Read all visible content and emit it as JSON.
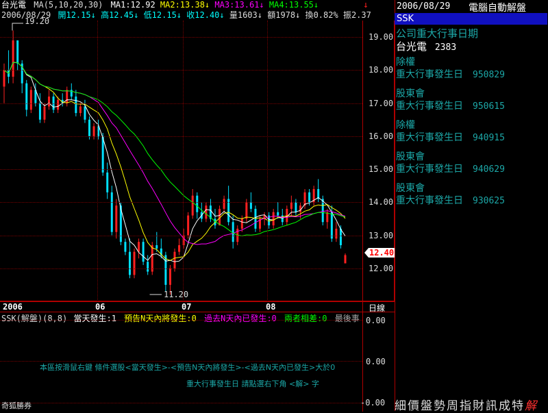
{
  "header": {
    "stock_name": "台光電",
    "ma_label": "MA(5,10,20,30)",
    "ma1": "MA1:12.92",
    "ma2": "MA2:13.38↓",
    "ma3": "MA3:13.61↓",
    "ma4": "MA4:13.55↓",
    "date": "2006/08/29",
    "open": "開12.15↓",
    "high": "高12.45↓",
    "low": "低12.15↓",
    "close": "收12.40↓",
    "volume": "量1603↓",
    "amount": "額1978↓",
    "turnover": "換0.82%",
    "amplitude": "振2.37",
    "arrow_icon": "down-arrow-icon"
  },
  "chart": {
    "yticks": [
      "19.00",
      "18.00",
      "17.00",
      "16.00",
      "15.00",
      "14.00",
      "13.00",
      "12.00"
    ],
    "current_price": "12.40",
    "high_label": "19.20",
    "low_label": "11.20",
    "xlabels": [
      "2006",
      "06",
      "07",
      "08"
    ],
    "period": "日線"
  },
  "chart_data": {
    "type": "candlestick",
    "ylim": [
      11.0,
      19.5
    ],
    "moving_averages": [
      {
        "name": "MA1",
        "last": 12.92,
        "color": "#ffffff"
      },
      {
        "name": "MA2",
        "last": 13.38,
        "color": "#ffff00"
      },
      {
        "name": "MA3",
        "last": 13.61,
        "color": "#ff00ff"
      },
      {
        "name": "MA4",
        "last": 13.55,
        "color": "#00ff00"
      }
    ],
    "candles": [
      [
        17.5,
        18.2,
        17.0,
        18.0
      ],
      [
        18.0,
        18.6,
        17.6,
        17.8
      ],
      [
        17.8,
        19.2,
        17.6,
        18.9
      ],
      [
        18.9,
        18.9,
        18.0,
        18.2
      ],
      [
        18.2,
        18.3,
        17.3,
        17.6
      ],
      [
        17.6,
        17.7,
        16.6,
        16.8
      ],
      [
        16.8,
        17.5,
        16.7,
        17.4
      ],
      [
        17.4,
        17.6,
        16.9,
        17.0
      ],
      [
        17.0,
        17.3,
        16.4,
        16.5
      ],
      [
        16.5,
        17.0,
        16.4,
        16.9
      ],
      [
        16.9,
        17.4,
        16.8,
        17.2
      ],
      [
        17.2,
        17.3,
        16.7,
        16.8
      ],
      [
        16.8,
        17.2,
        16.7,
        17.1
      ],
      [
        17.1,
        17.3,
        16.9,
        17.0
      ],
      [
        17.0,
        17.5,
        16.9,
        17.4
      ],
      [
        17.4,
        17.6,
        17.1,
        17.2
      ],
      [
        17.2,
        17.4,
        16.6,
        16.7
      ],
      [
        16.7,
        17.0,
        16.6,
        16.9
      ],
      [
        16.9,
        17.1,
        16.4,
        16.5
      ],
      [
        16.5,
        16.6,
        15.9,
        16.0
      ],
      [
        16.0,
        16.4,
        15.9,
        16.3
      ],
      [
        16.3,
        16.5,
        15.9,
        16.0
      ],
      [
        16.0,
        16.1,
        14.8,
        14.9
      ],
      [
        14.9,
        15.2,
        14.1,
        14.3
      ],
      [
        14.3,
        14.5,
        13.0,
        13.1
      ],
      [
        13.1,
        14.1,
        12.9,
        13.9
      ],
      [
        13.9,
        14.0,
        12.7,
        12.8
      ],
      [
        12.8,
        12.9,
        12.4,
        12.5
      ],
      [
        12.5,
        12.9,
        11.7,
        11.8
      ],
      [
        11.8,
        12.6,
        11.7,
        12.5
      ],
      [
        12.5,
        12.9,
        12.3,
        12.8
      ],
      [
        12.8,
        12.9,
        12.1,
        12.2
      ],
      [
        12.2,
        12.4,
        11.8,
        11.9
      ],
      [
        11.9,
        12.8,
        11.8,
        12.7
      ],
      [
        12.7,
        13.1,
        12.5,
        12.6
      ],
      [
        12.6,
        12.9,
        12.3,
        12.4
      ],
      [
        12.4,
        12.5,
        11.3,
        11.5
      ],
      [
        11.5,
        12.1,
        11.2,
        12.0
      ],
      [
        12.0,
        12.6,
        11.9,
        12.5
      ],
      [
        12.5,
        12.9,
        12.4,
        12.7
      ],
      [
        12.7,
        13.2,
        12.6,
        13.0
      ],
      [
        13.0,
        13.7,
        12.9,
        13.6
      ],
      [
        13.6,
        14.4,
        13.5,
        14.2
      ],
      [
        14.2,
        14.3,
        13.5,
        13.7
      ],
      [
        13.7,
        14.0,
        13.4,
        13.5
      ],
      [
        13.5,
        14.0,
        13.4,
        13.9
      ],
      [
        13.9,
        14.1,
        13.4,
        13.5
      ],
      [
        13.5,
        13.8,
        13.2,
        13.3
      ],
      [
        13.3,
        13.9,
        13.3,
        13.8
      ],
      [
        13.8,
        14.2,
        13.7,
        14.1
      ],
      [
        14.1,
        14.5,
        13.3,
        13.4
      ],
      [
        13.4,
        13.6,
        12.6,
        12.8
      ],
      [
        12.8,
        13.3,
        12.7,
        13.2
      ],
      [
        13.2,
        13.6,
        13.1,
        13.5
      ],
      [
        13.5,
        14.1,
        13.4,
        14.0
      ],
      [
        14.0,
        14.3,
        13.7,
        13.8
      ],
      [
        13.8,
        13.9,
        13.1,
        13.2
      ],
      [
        13.2,
        13.6,
        13.1,
        13.5
      ],
      [
        13.5,
        13.7,
        13.3,
        13.6
      ],
      [
        13.6,
        13.7,
        13.2,
        13.3
      ],
      [
        13.3,
        13.8,
        13.2,
        13.7
      ],
      [
        13.7,
        14.0,
        13.5,
        13.6
      ],
      [
        13.6,
        13.8,
        13.3,
        13.4
      ],
      [
        13.4,
        13.9,
        13.3,
        13.8
      ],
      [
        13.8,
        14.2,
        13.6,
        14.0
      ],
      [
        14.0,
        14.1,
        13.6,
        13.7
      ],
      [
        13.7,
        14.0,
        13.5,
        13.9
      ],
      [
        13.9,
        14.4,
        13.8,
        14.3
      ],
      [
        14.3,
        14.4,
        13.9,
        14.0
      ],
      [
        14.0,
        14.5,
        13.9,
        14.4
      ],
      [
        14.4,
        14.7,
        14.0,
        14.1
      ],
      [
        14.1,
        14.2,
        13.3,
        13.4
      ],
      [
        13.4,
        13.8,
        13.2,
        13.7
      ],
      [
        13.7,
        13.9,
        12.8,
        12.9
      ],
      [
        12.9,
        13.4,
        12.8,
        13.2
      ],
      [
        13.2,
        13.3,
        12.6,
        12.7
      ],
      [
        12.15,
        12.45,
        12.15,
        12.4
      ]
    ]
  },
  "indicator": {
    "title": "SSK(解盤)(8,8)",
    "today": "當天發生:1",
    "predict": "預告N天內將發生:0",
    "past": "過去N天內已發生:0",
    "diff": "兩者相差:0",
    "last": "最後事",
    "yticks": [
      "0.00",
      "0.00",
      "-0.00"
    ],
    "hint1": "本區按滑鼠右鍵 條件選股<當天發生>-<預告N天內將發生>-<過去N天內已發生>大於0",
    "hint2": "重大行事發生日 請點選右下角 <解> 字",
    "footer": "奇狐勝券"
  },
  "right_panel": {
    "date": "2006/08/29",
    "title": "電腦自動解盤",
    "ssk": "SSK",
    "heading": "公司重大行事日期",
    "stock_name": "台光電",
    "stock_code": "2383",
    "events": [
      {
        "type": "除權",
        "label": "重大行事發生日",
        "date": "950829"
      },
      {
        "type": "股東會",
        "label": "重大行事發生日",
        "date": "950615"
      },
      {
        "type": "除權",
        "label": "重大行事發生日",
        "date": "940915"
      },
      {
        "type": "股東會",
        "label": "重大行事發生日",
        "date": "940629"
      },
      {
        "type": "股東會",
        "label": "重大行事發生日",
        "date": "930625"
      }
    ],
    "tabs": [
      "細",
      "價",
      "盤",
      "勢",
      "周",
      "指",
      "財",
      "訊",
      "成",
      "特",
      "解"
    ]
  }
}
